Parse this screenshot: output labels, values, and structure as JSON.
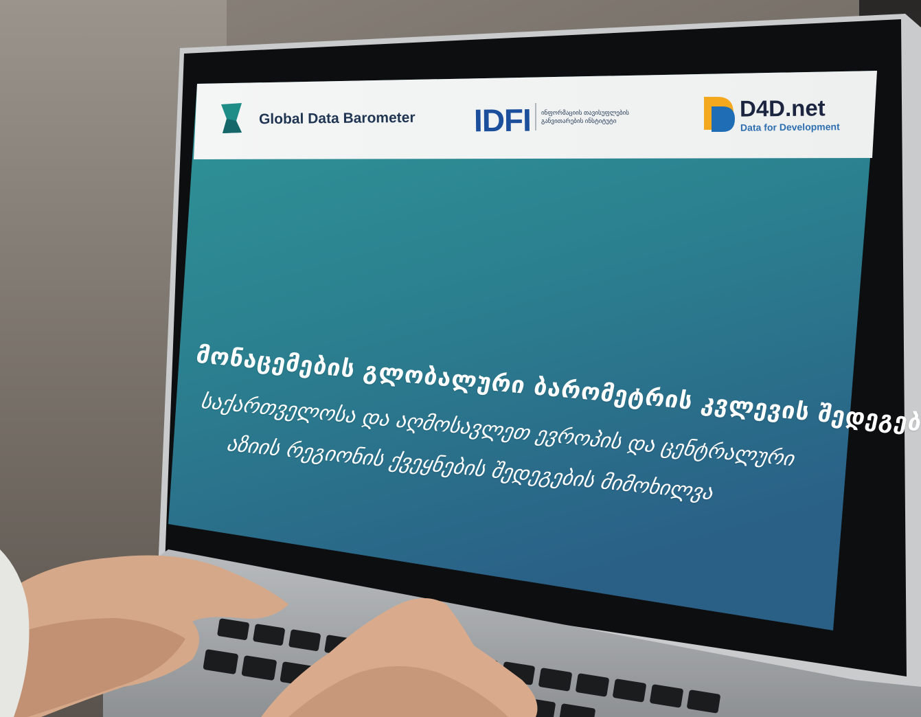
{
  "screen": {
    "header": {
      "left_logo_label": "Global Data Barometer",
      "center_logo_text": "IDFI",
      "center_logo_subtext": "ინფორმაციის თავისუფლების განვითარების ინსტიტუტი",
      "right_logo_title": "D4D.net",
      "right_logo_subtitle": "Data for Development"
    },
    "title": "მონაცემების გლობალური ბარომეტრის კვლევის შედეგები",
    "subtitle_line_1": "საქართველოსა და აღმოსავლეთ ევროპის და ცენტრალური",
    "subtitle_line_2": "აზიის რეგიონის ქვეყნების შედეგების მიმოხილვა"
  },
  "colors": {
    "screen_gradient_top": "#2e8e95",
    "screen_gradient_bottom": "#2a6b8a",
    "header_bar": "#f3f4f4",
    "gdb_logo": "#1f8a86",
    "idfi_blue": "#1b4f9c",
    "d4d_orange": "#f4a81d",
    "d4d_blue": "#1f6db5"
  }
}
